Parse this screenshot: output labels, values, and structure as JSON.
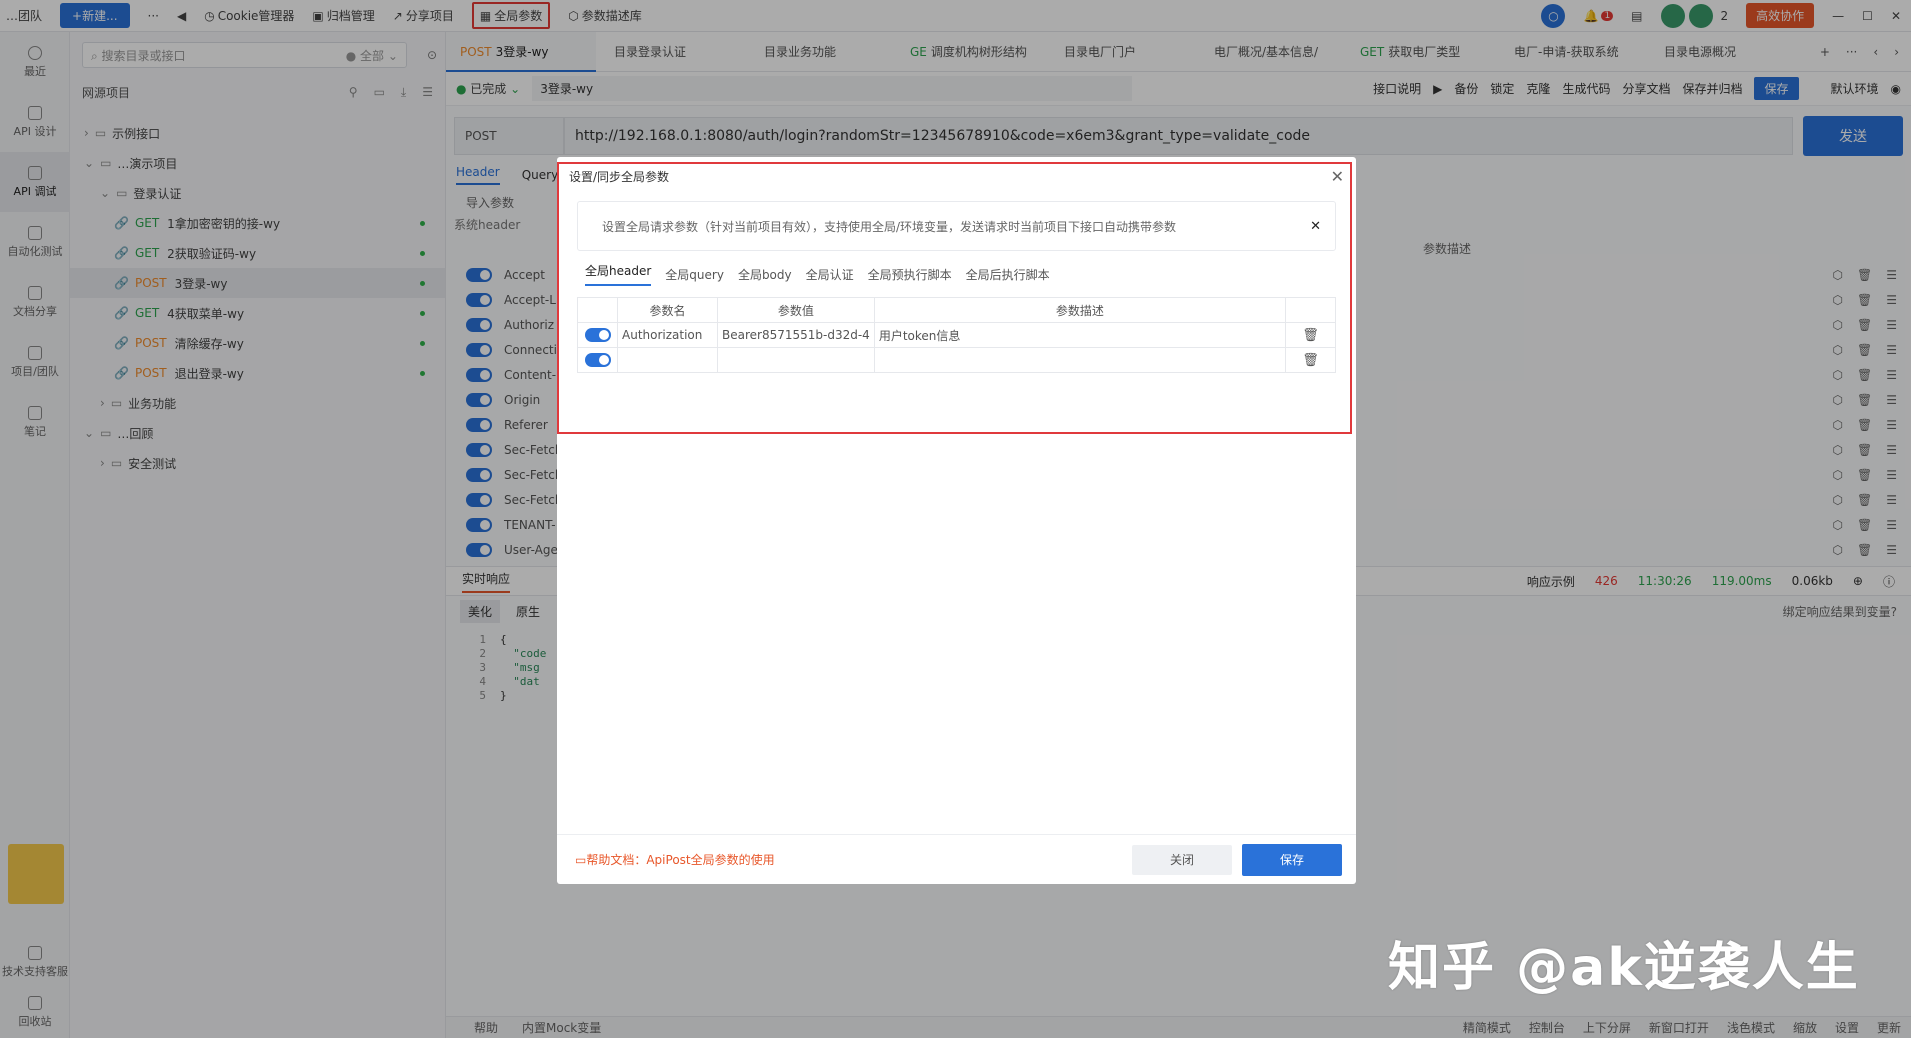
{
  "topbar": {
    "workspace": "…团队",
    "new_label": "+新建...",
    "more": "···",
    "back": "◀",
    "cookie": "Cookie管理器",
    "archive": "归档管理",
    "share": "分享项目",
    "global_params": "全局参数",
    "param_lib": "参数描述库",
    "notif_count": "1",
    "member_count": "2",
    "collab": "高效协作"
  },
  "rail": [
    "最近",
    "API 设计",
    "API 调试",
    "自动化测试",
    "文档分享",
    "项目/团队",
    "笔记",
    "技术支持客服",
    "回收站"
  ],
  "tree": {
    "search_placeholder": "搜索目录或接口",
    "filter": "全部",
    "section": "网源项目",
    "items": [
      {
        "label": "示例接口",
        "method": ""
      },
      {
        "label": "…演示项目",
        "method": ""
      },
      {
        "label": "登录认证",
        "method": ""
      },
      {
        "label": "1拿加密密钥的接-wy",
        "method": "GET"
      },
      {
        "label": "2获取验证码-wy",
        "method": "GET"
      },
      {
        "label": "3登录-wy",
        "method": "POST"
      },
      {
        "label": "4获取菜单-wy",
        "method": "GET"
      },
      {
        "label": "清除缓存-wy",
        "method": "POST"
      },
      {
        "label": "退出登录-wy",
        "method": "POST"
      },
      {
        "label": "业务功能",
        "method": ""
      },
      {
        "label": "…回顾",
        "method": ""
      },
      {
        "label": "安全测试",
        "method": ""
      }
    ]
  },
  "tabs": [
    {
      "method": "POST",
      "label": "3登录-wy"
    },
    {
      "method": "",
      "label": "目录登录认证"
    },
    {
      "method": "",
      "label": "目录业务功能"
    },
    {
      "method": "GE",
      "label": "调度机构树形结构"
    },
    {
      "method": "",
      "label": "目录电厂门户"
    },
    {
      "method": "",
      "label": "电厂概况/基本信息/"
    },
    {
      "method": "GET",
      "label": "获取电厂类型"
    },
    {
      "method": "",
      "label": "电厂-申请-获取系统"
    },
    {
      "method": "",
      "label": "目录电源概况"
    }
  ],
  "request": {
    "status": "已完成",
    "name": "3登录-wy",
    "actions": [
      "接口说明",
      "备份",
      "锁定",
      "克隆",
      "生成代码",
      "分享文档",
      "保存并归档"
    ],
    "save": "保存",
    "env": "默认环境",
    "method": "POST",
    "url": "http://192.168.0.1:8080/auth/login?randomStr=12345678910&code=x6em3&grant_type=validate_code",
    "send": "发送",
    "subtabs": [
      "Header",
      "Query"
    ],
    "import": "导入参数",
    "sys_header": "系统header",
    "col_desc": "参数描述",
    "headers": [
      "Accept",
      "Accept-L",
      "Authoriz",
      "Connectio",
      "Content-",
      "Origin",
      "Referer",
      "Sec-Fetch",
      "Sec-Fetch",
      "Sec-Fetch",
      "TENANT-",
      "User-Age"
    ]
  },
  "response": {
    "tab": "实时响应",
    "pretty": "美化",
    "raw": "原生",
    "example": "响应示例",
    "code": "426",
    "time": "11:30:26",
    "duration": "119.00ms",
    "size": "0.06kb",
    "bind": "绑定响应结果到变量?",
    "lines": [
      "{",
      "  \"code",
      "  \"msg",
      "  \"dat",
      "}"
    ]
  },
  "modal": {
    "title": "设置/同步全局参数",
    "tip": "设置全局请求参数（针对当前项目有效），支持使用全局/环境变量，发送请求时当前项目下接口自动携带参数",
    "tabs": [
      "全局header",
      "全局query",
      "全局body",
      "全局认证",
      "全局预执行脚本",
      "全局后执行脚本"
    ],
    "cols": [
      "参数名",
      "参数值",
      "参数描述"
    ],
    "rows": [
      {
        "name": "Authorization",
        "value": "Bearer8571551b-d32d-4",
        "desc": "用户token信息"
      },
      {
        "name": "",
        "value": "",
        "desc": ""
      }
    ],
    "help": "帮助文档：ApiPost全局参数的使用",
    "close": "关闭",
    "save": "保存"
  },
  "statusbar": [
    "帮助",
    "内置Mock变量",
    "精简模式",
    "控制台",
    "上下分屏",
    "新窗口打开",
    "浅色模式",
    "缩放",
    "设置",
    "更新"
  ],
  "watermark": "知乎 @ak逆袭人生"
}
